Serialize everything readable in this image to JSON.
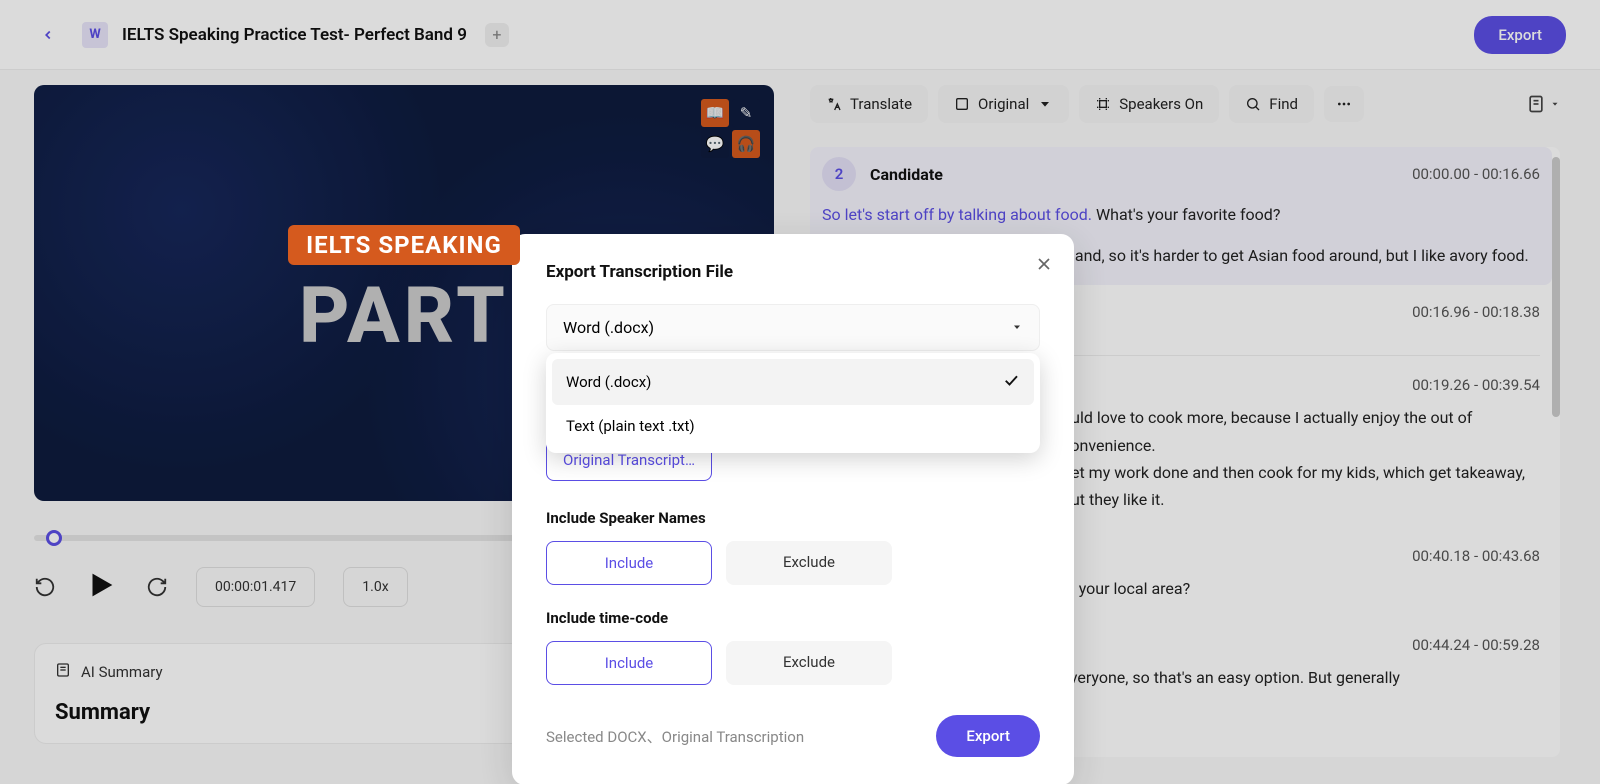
{
  "header": {
    "title": "IELTS Speaking Practice Test- Perfect Band 9",
    "export_label": "Export",
    "doc_icon_letter": "W"
  },
  "video": {
    "tag": "IELTS SPEAKING",
    "part": "PART"
  },
  "player": {
    "time": "00:00:01.417",
    "speed": "1.0x"
  },
  "ai_summary": {
    "header": "AI Summary",
    "title": "Summary"
  },
  "toolbar": {
    "translate": "Translate",
    "original": "Original",
    "speakers": "Speakers On",
    "find": "Find"
  },
  "transcript": {
    "segments": [
      {
        "avatar": "2",
        "speaker": "Candidate",
        "time": "00:00.00 - 00:16.66",
        "prompt": "So let's start off by talking about food.",
        "text": " What's your favorite food?",
        "highlight": true
      },
      {
        "speaker": "",
        "time": "00:16.96 - 00:18.38",
        "text_tail": "gland, so it's harder to get Asian food around, but I like avory food."
      },
      {
        "speaker": "",
        "time": "00:19.26 - 00:39.54",
        "text_tail": "ould love to cook more, because I actually enjoy the out of convenience.\nget my work done and then cook for my kids, which get takeaway, but they like it."
      },
      {
        "speaker": "",
        "time": "00:40.18 - 00:43.68",
        "text_tail": "in your local area?"
      },
      {
        "speaker": "",
        "time": "00:44.24 - 00:59.28",
        "text_tail": "Fish and chips. It's a favorite with everyone, so that's an easy option. But generally"
      }
    ]
  },
  "modal": {
    "title": "Export Transcription File",
    "select_value": "Word (.docx)",
    "options": [
      {
        "label": "Word (.docx)",
        "selected": true
      },
      {
        "label": "Text (plain text .txt)",
        "selected": false
      }
    ],
    "content_chip": "Original Transcripti…",
    "include_speaker_label": "Include Speaker Names",
    "include_timecode_label": "Include time-code",
    "include_opt": "Include",
    "exclude_opt": "Exclude",
    "selected_text": "Selected DOCX、Original Transcription",
    "export_btn": "Export"
  }
}
